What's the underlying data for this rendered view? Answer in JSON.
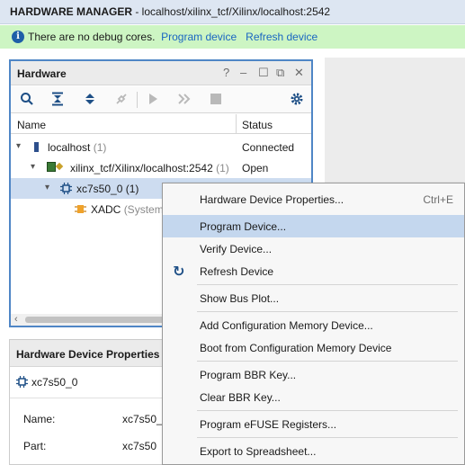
{
  "title": {
    "prefix": "HARDWARE MANAGER",
    "path": " - localhost/xilinx_tcf/Xilinx/localhost:2542"
  },
  "infobar": {
    "icon": "info-icon",
    "message": "There are no debug cores.",
    "link1": "Program device",
    "link2": "Refresh device",
    "bg": "#cdf5c3"
  },
  "hardware": {
    "title": "Hardware",
    "controls": {
      "help": "?",
      "min": "–",
      "max": "☐",
      "float": "⧉",
      "close": "✕"
    },
    "columns": {
      "name": "Name",
      "status": "Status"
    },
    "rows": [
      {
        "icon": "server-icon",
        "label": "localhost",
        "count": "(1)",
        "status": "Connected"
      },
      {
        "icon": "board-chip-icon",
        "label": "xilinx_tcf/Xilinx/localhost:2542",
        "count": "(1)",
        "status": "Open"
      },
      {
        "icon": "device-chip-icon",
        "label": "xc7s50_0",
        "count": "(1)",
        "status": ""
      },
      {
        "icon": "xadc-icon",
        "label": "XADC",
        "count": "(System",
        "status": ""
      }
    ]
  },
  "properties": {
    "title": "Hardware Device Properties",
    "device": "xc7s50_0",
    "fields": [
      {
        "key": "Name:",
        "value": "xc7s50_"
      },
      {
        "key": "Part:",
        "value": "xc7s50"
      }
    ]
  },
  "menu": {
    "items": [
      {
        "label": "Hardware Device Properties...",
        "shortcut": "Ctrl+E"
      },
      {
        "label": "Program Device...",
        "highlighted": true
      },
      {
        "label": "Verify Device..."
      },
      {
        "label": "Refresh Device",
        "icon": "refresh-icon"
      },
      {
        "label": "Show Bus Plot..."
      },
      {
        "label": "Add Configuration Memory Device..."
      },
      {
        "label": "Boot from Configuration Memory Device"
      },
      {
        "label": "Program BBR Key..."
      },
      {
        "label": "Clear BBR Key..."
      },
      {
        "label": "Program eFUSE Registers..."
      },
      {
        "label": "Export to Spreadsheet..."
      }
    ]
  },
  "colors": {
    "accent": "#4f86c6",
    "link": "#1a66c2",
    "selection": "#cddcf0",
    "menu_highlight": "#c4d7ee"
  }
}
